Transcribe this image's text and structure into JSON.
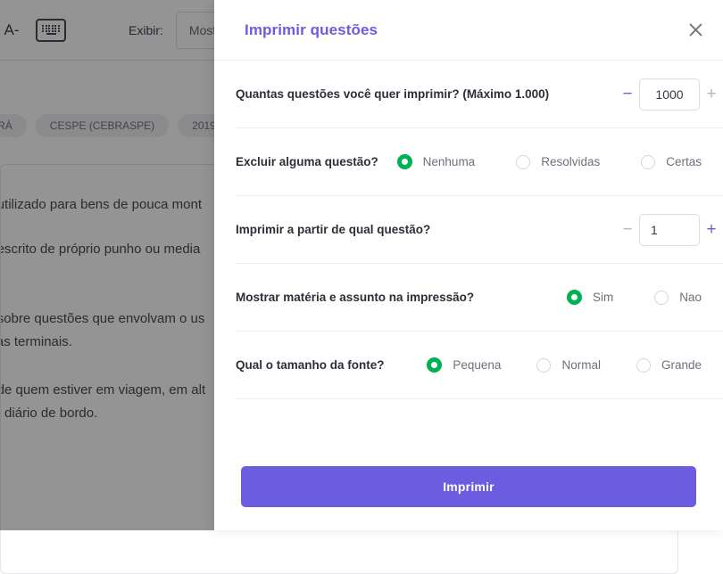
{
  "background": {
    "toolbar": {
      "font_decrease_label": "A-",
      "keyboard_icon_name": "keyboard-icon",
      "display_label": "Exibir:",
      "display_select_value": "Mostrar T"
    },
    "tags": [
      "PARÁ",
      "CESPE (CEBRASPE)",
      "2019"
    ],
    "content_lines": [
      "ntade utilizado para bens de pouca mont",
      "ntade escrito de próprio punho ou media",
      "ntade sobre questões que envolvam o us",
      "doenças terminais.",
      "ntade de quem estiver em viagem, em alt",
      "ado no diário de bordo."
    ]
  },
  "modal": {
    "title": "Imprimir questões",
    "close_icon": "close-icon",
    "rows": [
      {
        "label": "Quantas questões você quer imprimir? (Máximo 1.000)",
        "type": "stepper",
        "decrement_label": "−",
        "increment_label": "+",
        "decrement_state": "active",
        "increment_state": "muted",
        "value": "1000",
        "align": "center"
      },
      {
        "label": "Excluir alguma questão?",
        "type": "radios",
        "options": [
          {
            "label": "Nenhuma",
            "selected": true
          },
          {
            "label": "Resolvidas",
            "selected": false
          },
          {
            "label": "Certas",
            "selected": false
          }
        ]
      },
      {
        "label": "Imprimir a partir de qual questão?",
        "type": "stepper",
        "decrement_label": "−",
        "increment_label": "+",
        "decrement_state": "muted",
        "increment_state": "active",
        "value": "1",
        "align": "left"
      },
      {
        "label": "Mostrar matéria e assunto na impressão?",
        "type": "radios",
        "options": [
          {
            "label": "Sim",
            "selected": true
          },
          {
            "label": "Nao",
            "selected": false
          }
        ]
      },
      {
        "label": "Qual o tamanho da fonte?",
        "type": "radios",
        "options": [
          {
            "label": "Pequena",
            "selected": true
          },
          {
            "label": "Normal",
            "selected": false
          },
          {
            "label": "Grande",
            "selected": false
          }
        ]
      }
    ],
    "submit_label": "Imprimir"
  },
  "colors": {
    "accent_purple": "#6c5ce0",
    "radio_green": "#00b152",
    "overlay": "rgba(0,0,0,0.42)"
  }
}
